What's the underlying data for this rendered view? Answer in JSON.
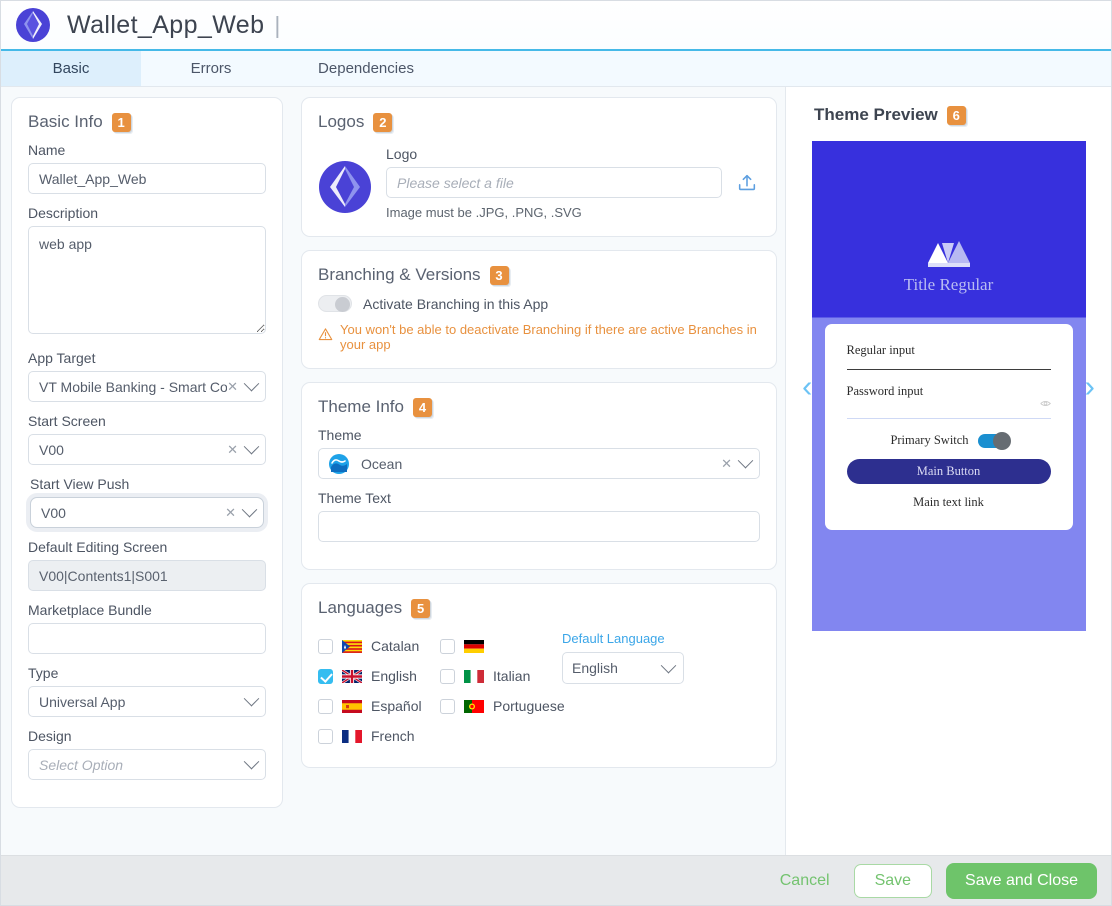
{
  "titlebar": {
    "app_title": "Wallet_App_Web",
    "caret": "|",
    "logo_icon": "app-logo-icon"
  },
  "tabs": [
    {
      "label": "Basic",
      "active": true
    },
    {
      "label": "Errors",
      "active": false
    },
    {
      "label": "Dependencies",
      "active": false
    }
  ],
  "basic_info": {
    "title": "Basic Info",
    "badge": "1",
    "name_label": "Name",
    "name_value": "Wallet_App_Web",
    "description_label": "Description",
    "description_value": "web app",
    "app_target_label": "App Target",
    "app_target_value": "VT Mobile Banking - Smart Conf",
    "start_screen_label": "Start Screen",
    "start_screen_value": "V00",
    "start_view_push_label": "Start View Push",
    "start_view_push_value": "V00",
    "default_editing_screen_label": "Default Editing Screen",
    "default_editing_screen_value": "V00|Contents1|S001",
    "marketplace_bundle_label": "Marketplace Bundle",
    "marketplace_bundle_value": "",
    "type_label": "Type",
    "type_value": "Universal App",
    "design_label": "Design",
    "design_placeholder": "Select Option",
    "clear_icon": "clear-x-icon",
    "dropdown_icon": "chevron-down-icon"
  },
  "logos": {
    "title": "Logos",
    "badge": "2",
    "logo_label": "Logo",
    "file_placeholder": "Please select a file",
    "hint": "Image must be .JPG, .PNG, .SVG",
    "thumb_icon": "logo-thumbnail-icon",
    "upload_icon": "upload-icon"
  },
  "branching": {
    "title": "Branching & Versions",
    "badge": "3",
    "toggle_label": "Activate Branching in this App",
    "toggle_on": false,
    "warning_icon": "warning-triangle-icon",
    "warning": "You won't be able to deactivate Branching if there are active Branches in your app"
  },
  "theme_info": {
    "title": "Theme Info",
    "badge": "4",
    "theme_label": "Theme",
    "theme_value": "Ocean",
    "theme_icon": "ocean-wave-icon",
    "theme_text_label": "Theme Text",
    "theme_text_value": ""
  },
  "languages": {
    "title": "Languages",
    "badge": "5",
    "column1": [
      {
        "name": "Catalan",
        "checked": false,
        "flag": "catalan-flag-icon"
      },
      {
        "name": "English",
        "checked": true,
        "flag": "uk-flag-icon"
      },
      {
        "name": "Español",
        "checked": false,
        "flag": "spain-flag-icon"
      },
      {
        "name": "French",
        "checked": false,
        "flag": "france-flag-icon"
      }
    ],
    "column2": [
      {
        "name": "",
        "checked": false,
        "flag": "germany-flag-icon"
      },
      {
        "name": "Italian",
        "checked": false,
        "flag": "italy-flag-icon"
      },
      {
        "name": "Portuguese",
        "checked": false,
        "flag": "portugal-flag-icon"
      }
    ],
    "default_language_label": "Default Language",
    "default_language_value": "English"
  },
  "theme_preview": {
    "title": "Theme Preview",
    "badge": "6",
    "prev_arrow": "‹",
    "next_arrow": "›",
    "phone_logo_icon": "theme-logo-icon",
    "phone_title": "Title Regular",
    "regular_input_label": "Regular input",
    "password_input_label": "Password input",
    "eye_icon": "eye-icon",
    "switch_label": "Primary Switch",
    "switch_on": true,
    "main_button_label": "Main Button",
    "text_link_label": "Main text link",
    "colors": {
      "top": "#3730dd",
      "bottom": "#8286f0",
      "button": "#2d2f8f",
      "switch": "#1a8fd0"
    }
  },
  "footer": {
    "cancel_label": "Cancel",
    "save_label": "Save",
    "save_close_label": "Save and Close"
  }
}
